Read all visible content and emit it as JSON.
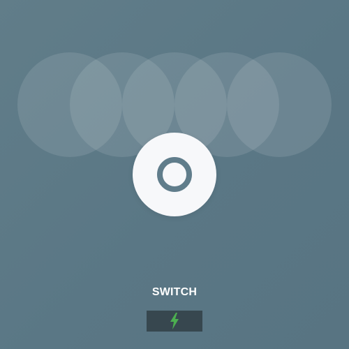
{
  "switch": {
    "label": "SWITCH",
    "state": "off",
    "icon": "power-ring-icon"
  },
  "indicator": {
    "icon": "lightning-bolt-icon",
    "color": "#4caf50"
  },
  "colors": {
    "background": "#5f7b88",
    "toggle": "#f7f8fa",
    "ring": "#607d8b",
    "indicator_bg": "#37474f"
  }
}
